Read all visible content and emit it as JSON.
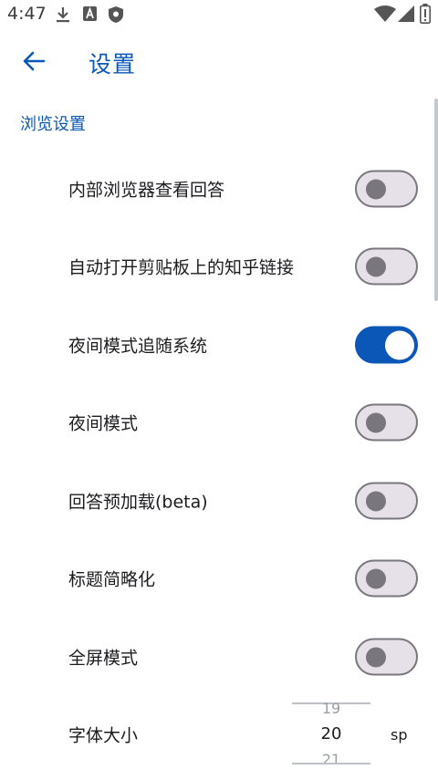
{
  "status_bar": {
    "time": "4:47",
    "icons_left": [
      "download-icon",
      "a-box-icon",
      "shield-icon"
    ],
    "icons_right": [
      "wifi-icon",
      "signal-icon",
      "battery-icon"
    ]
  },
  "app_bar": {
    "back_icon": "arrow-back-icon",
    "title": "设置"
  },
  "section": {
    "title": "浏览设置"
  },
  "prefs": [
    {
      "label": "内部浏览器查看回答",
      "checked": false
    },
    {
      "label": "自动打开剪贴板上的知乎链接",
      "checked": false
    },
    {
      "label": "夜间模式追随系统",
      "checked": true
    },
    {
      "label": "夜间模式",
      "checked": false
    },
    {
      "label": "回答预加载(beta)",
      "checked": false
    },
    {
      "label": "标题简略化",
      "checked": false
    },
    {
      "label": "全屏模式",
      "checked": false
    }
  ],
  "font_size": {
    "label": "字体大小",
    "prev_value": "19",
    "value": "20",
    "next_value": "21",
    "unit": "sp"
  },
  "colors": {
    "accent": "#0b57b8",
    "switch_off_track": "#e6e1e9",
    "switch_off_outline": "#79767d"
  }
}
